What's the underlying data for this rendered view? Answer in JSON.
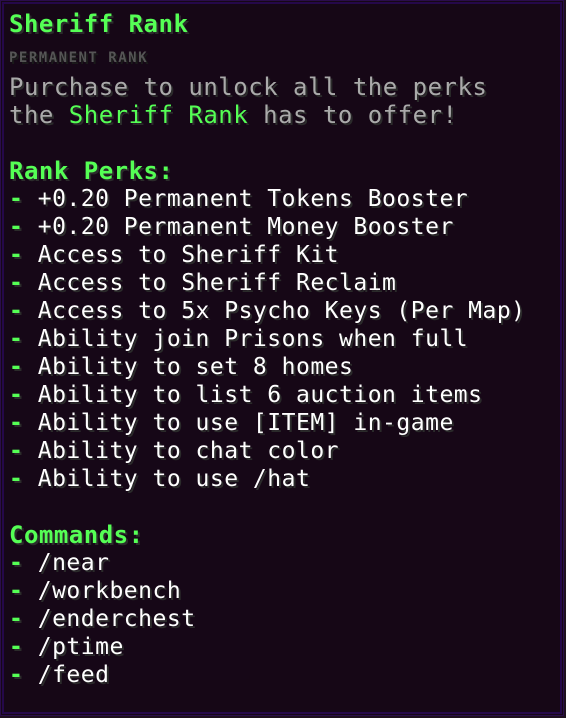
{
  "tooltip": {
    "title": "Sheriff Rank",
    "subtitle": "PERMANENT RANK",
    "description_line1": "Purchase to unlock all the perks",
    "description_line2_pre": "the ",
    "description_line2_rank": "Sheriff Rank",
    "description_line2_post": " has to offer!",
    "perks_header": "Rank Perks:",
    "bullet": "-",
    "perks": [
      "+0.20 Permanent Tokens Booster",
      "+0.20 Permanent Money Booster",
      "Access to Sheriff Kit",
      "Access to Sheriff Reclaim",
      "Access to 5x Psycho Keys (Per Map)",
      "Ability join Prisons when full",
      "Ability to set 8 homes",
      "Ability to list 6 auction items",
      "Ability to use [ITEM] in-game",
      "Ability to chat color",
      "Ability to use /hat"
    ],
    "commands_header": "Commands:",
    "commands": [
      "/near",
      "/workbench",
      "/enderchest",
      "/ptime",
      "/feed"
    ]
  },
  "colors": {
    "accent_green": "#55ff55",
    "description_gray": "#aaaaaa",
    "subtitle_gray": "#555555",
    "text_white": "#ffffff",
    "tooltip_background": "#160616",
    "tooltip_border": "#25084a"
  }
}
